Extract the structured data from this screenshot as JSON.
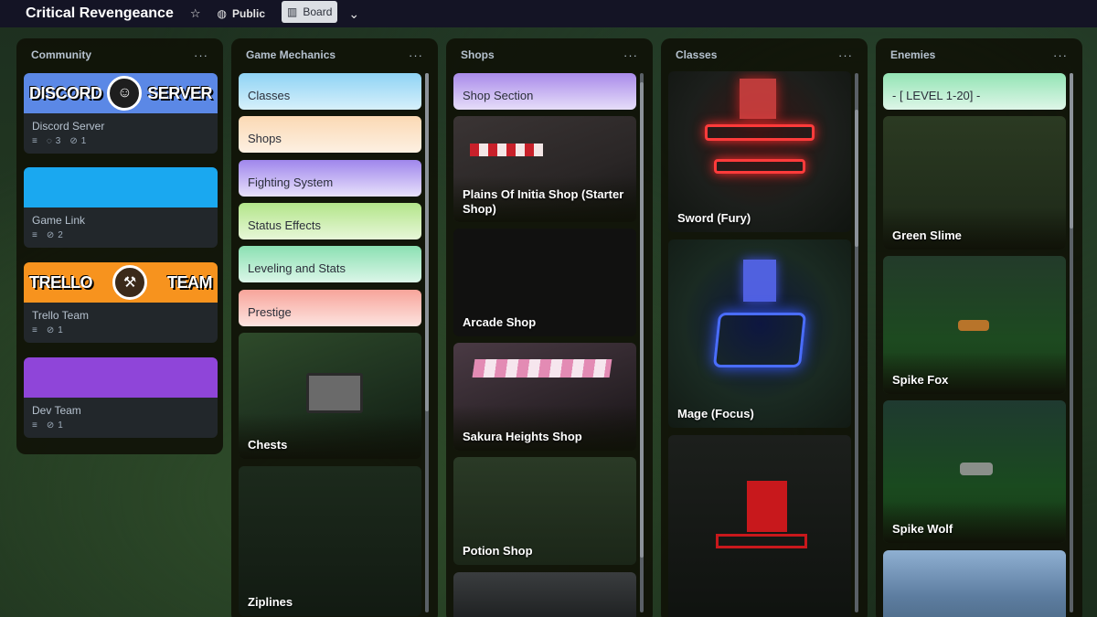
{
  "board": {
    "title": "Critical Revengeance",
    "visibility": "Public",
    "view": "Board"
  },
  "lists": {
    "community": {
      "title": "Community",
      "cards": [
        {
          "title": "Discord Server",
          "cover_left": "DISCORD",
          "cover_right": "SERVER",
          "comments": "3",
          "attachments": "1"
        },
        {
          "title": "Game Link",
          "attachments": "2"
        },
        {
          "title": "Trello Team",
          "cover_left": "TRELLO",
          "cover_right": "TEAM",
          "attachments": "1"
        },
        {
          "title": "Dev Team",
          "attachments": "1"
        }
      ]
    },
    "mechanics": {
      "title": "Game Mechanics",
      "cards": [
        {
          "title": "Classes"
        },
        {
          "title": "Shops"
        },
        {
          "title": "Fighting System"
        },
        {
          "title": "Status Effects"
        },
        {
          "title": "Leveling and Stats"
        },
        {
          "title": "Prestige"
        },
        {
          "title": "Chests"
        },
        {
          "title": "Ziplines"
        }
      ]
    },
    "shops": {
      "title": "Shops",
      "cards": [
        {
          "title": "Shop Section"
        },
        {
          "title": "Plains Of Initia Shop (Starter Shop)"
        },
        {
          "title": "Arcade Shop"
        },
        {
          "title": "Sakura Heights Shop"
        },
        {
          "title": "Potion Shop"
        }
      ]
    },
    "classes": {
      "title": "Classes",
      "cards": [
        {
          "title": "Sword (Fury)"
        },
        {
          "title": "Mage (Focus)"
        }
      ]
    },
    "enemies": {
      "title": "Enemies",
      "cards": [
        {
          "title": "- [ LEVEL 1-20] -"
        },
        {
          "title": "Green Slime"
        },
        {
          "title": "Spike Fox"
        },
        {
          "title": "Spike Wolf"
        }
      ]
    }
  },
  "colors": {
    "classes": "#8fd3f4",
    "shops": "#fbd9b4",
    "fighting": "#b39af0",
    "status": "#b3e58a",
    "leveling": "#8be0b2",
    "prestige": "#f7a49a",
    "shop_section": "#a98bea",
    "level_band": "#93e4b4",
    "discord": "#5b88e6",
    "game_link": "#1aa8f0",
    "trello": "#f7931e",
    "dev_team": "#8f45d9"
  },
  "icons": {
    "star": "star-icon",
    "globe": "globe-icon",
    "board": "board-icon",
    "menu": "more-icon",
    "description": "description-icon",
    "comment": "comment-icon",
    "attachment": "attachment-icon"
  }
}
